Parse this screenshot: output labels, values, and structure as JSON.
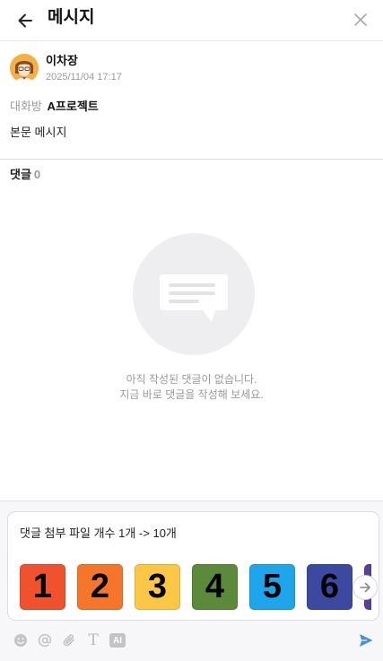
{
  "header": {
    "title": "메시지",
    "back_icon": "arrow-left-icon",
    "close_icon": "close-icon"
  },
  "message": {
    "author": "이차장",
    "date": "2025/11/04 17:17",
    "room_label": "대화방",
    "room_name": "A프로젝트",
    "body": "본문 메시지"
  },
  "comments": {
    "label": "댓글",
    "count": "0",
    "empty_line1": "아직 작성된 댓글이 없습니다.",
    "empty_line2": "지금 바로 댓글을 작성해 보세요."
  },
  "composer": {
    "text": "댓글 첨부 파일 개수 1개 -> 10개",
    "attachments": [
      {
        "label": "1",
        "color": "#f0522e"
      },
      {
        "label": "2",
        "color": "#f5762a"
      },
      {
        "label": "3",
        "color": "#fcc745"
      },
      {
        "label": "4",
        "color": "#5a8a3a"
      },
      {
        "label": "5",
        "color": "#1da6ec"
      },
      {
        "label": "6",
        "color": "#3b4aa0"
      }
    ],
    "next_icon": "arrow-right-icon"
  },
  "toolbar": {
    "tools": [
      "emoji-icon",
      "mention-icon",
      "attach-icon",
      "text-format-icon",
      "ai-icon"
    ],
    "ai_label": "AI",
    "text_label": "T",
    "send_icon": "send-icon"
  },
  "colors": {
    "send": "#4a90d9",
    "muted": "#9a9a9a"
  }
}
